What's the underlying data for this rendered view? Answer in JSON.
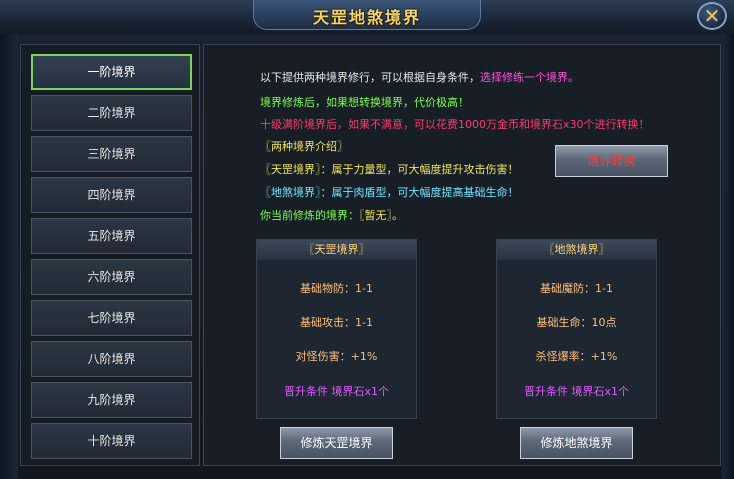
{
  "window": {
    "title": "天罡地煞境界",
    "close_glyph": "✕"
  },
  "tiers": [
    "一阶境界",
    "二阶境界",
    "三阶境界",
    "四阶境界",
    "五阶境界",
    "六阶境界",
    "七阶境界",
    "八阶境界",
    "九阶境界",
    "十阶境界"
  ],
  "active_tier": 0,
  "intro": {
    "line1_a": "以下提供两种境界修行，可以根据自身条件，",
    "line1_b": "选择修练一个境界。",
    "line2": "境界修炼后，如果想转换境界，代价极高！",
    "line3": "十级满阶境界后，如果不满意，可以花费1000万金币和境界石x30个进行转换！",
    "line4": "〖两种境界介绍〗",
    "line5": "〖天罡境界〗：属于力量型，可大幅度提升攻击伤害！",
    "line6": "〖地煞境界〗：属于肉盾型，可大幅度提高基础生命！",
    "line7_a": "你当前修炼的境界：",
    "line7_b": "〖暂无〗。"
  },
  "switch_button": "境界转换",
  "tiangang": {
    "header": "〖天罡境界〗",
    "stat1": "基础物防：1-1",
    "stat2": "基础攻击：1-1",
    "stat3": "对怪伤害：+1%",
    "req": "晋升条件 境界石x1个",
    "button": "修炼天罡境界"
  },
  "disha": {
    "header": "〖地煞境界〗",
    "stat1": "基础魔防：1-1",
    "stat2": "基础生命：10点",
    "stat3": "杀怪爆率：+1%",
    "req": "晋升条件 境界石x1个",
    "button": "修炼地煞境界"
  },
  "colors": {
    "title": "#f5d66a",
    "active_border": "#7ad35e",
    "switch_text": "#ff3a3a",
    "train_text": "#ffffff"
  }
}
